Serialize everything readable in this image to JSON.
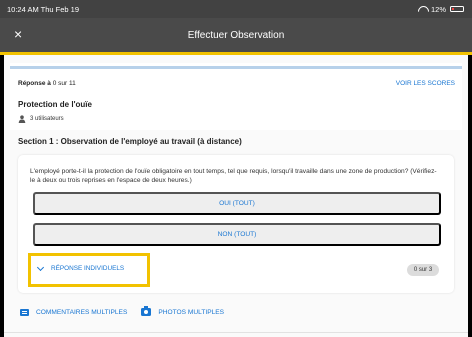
{
  "status": {
    "time": "10:24 AM",
    "date": "Thu Feb 19",
    "battery": "12%"
  },
  "appbar": {
    "title": "Effectuer Observation",
    "close": "×"
  },
  "score": {
    "response_prefix": "Réponse à",
    "response_count": "0 sur 11",
    "view_scores": "VOIR LES SCORES",
    "title": "Protection de l'ouïe",
    "users": "3 utilisateurs",
    "progress": 0
  },
  "section": {
    "title": "Section 1 : Observation de l'employé au travail (à distance)"
  },
  "question": {
    "text": "L'employé porte-t-il la protection de l'ouïe obligatoire en tout temps, tel que requis, lorsqu'il travaille dans une zone de production? (Vérifiez-le à deux ou trois reprises en l'espace de deux heures.)",
    "options": [
      "OUI (TOUT)",
      "NON (TOUT)"
    ],
    "individual": "RÉPONSE INDIVIDUELS",
    "individual_count": "0 sur 3"
  },
  "actions": {
    "comments": "COMMENTAIRES MULTIPLES",
    "photos": "PHOTOS MULTIPLES"
  },
  "colors": {
    "accent": "#1976d2",
    "highlight": "#f2c200",
    "header": "#4a4a4a"
  },
  "icons": [
    "close-icon",
    "wifi-icon",
    "battery-icon",
    "user-icon",
    "chevron-down-icon",
    "comment-icon",
    "camera-icon"
  ]
}
